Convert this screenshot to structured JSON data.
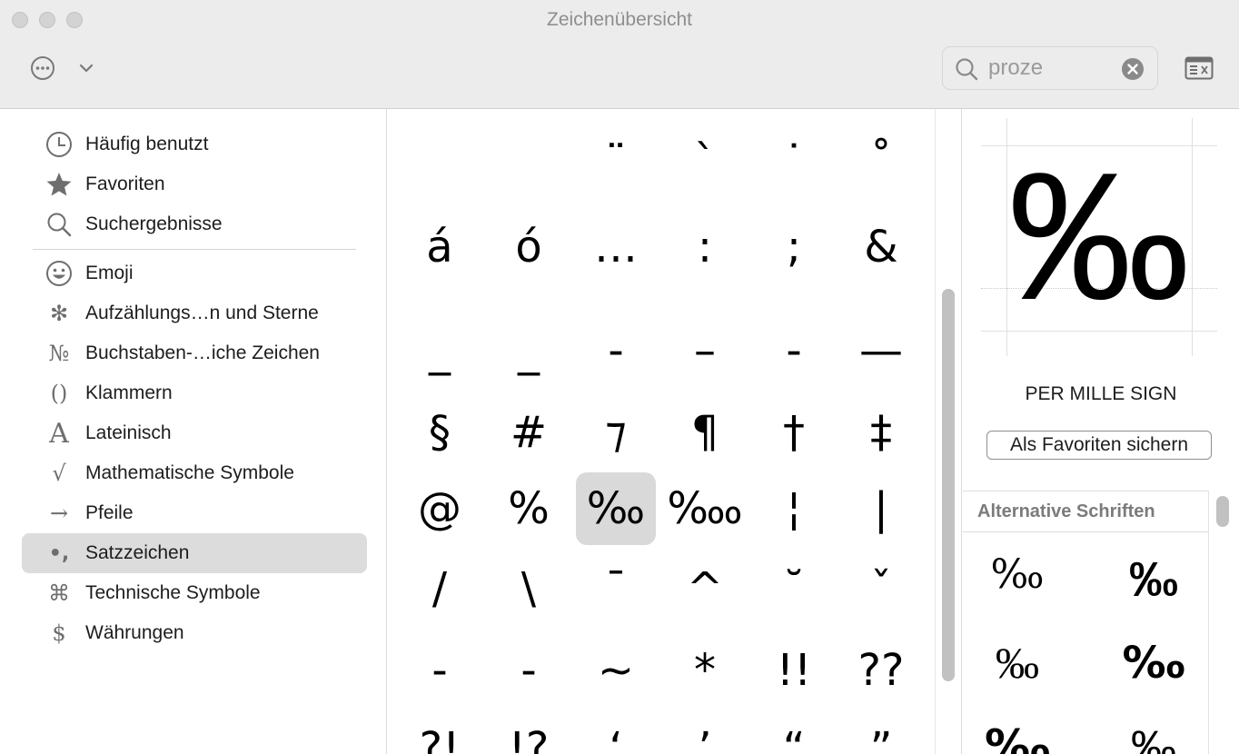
{
  "window": {
    "title": "Zeichenübersicht"
  },
  "toolbar": {
    "search_value": "proze",
    "icons": {
      "more": "ellipsis-circle-icon",
      "dropdown": "chevron-down-icon",
      "search": "magnifier-icon",
      "clear": "clear-x-icon",
      "keyboard_viewer": "keyboard-viewer-icon"
    }
  },
  "sidebar": {
    "items": [
      {
        "label": "Häufig benutzt",
        "icon": "clock-icon"
      },
      {
        "label": "Favoriten",
        "icon": "star-icon"
      },
      {
        "label": "Suchergebnisse",
        "icon": "magnifier-icon"
      },
      {
        "label": "Emoji",
        "icon": "smiley-icon",
        "glyph": "☺"
      },
      {
        "label": "Aufzählungs…n und Sterne",
        "icon": "asterisk-bullet-icon",
        "glyph": "✻"
      },
      {
        "label": "Buchstaben-…iche Zeichen",
        "icon": "numero-icon",
        "glyph": "№"
      },
      {
        "label": "Klammern",
        "icon": "parentheses-icon",
        "glyph": "()"
      },
      {
        "label": "Lateinisch",
        "icon": "latin-a-icon",
        "glyph": "A"
      },
      {
        "label": "Mathematische Symbole",
        "icon": "square-root-icon",
        "glyph": "√"
      },
      {
        "label": "Pfeile",
        "icon": "arrow-right-icon",
        "glyph": "→"
      },
      {
        "label": "Satzzeichen",
        "icon": "punctuation-icon",
        "glyph": "•,"
      },
      {
        "label": "Technische Symbole",
        "icon": "command-icon",
        "glyph": "⌘"
      },
      {
        "label": "Währungen",
        "icon": "dollar-icon",
        "glyph": "$"
      }
    ],
    "selected": "Satzzeichen"
  },
  "grid": {
    "rows": [
      [
        "",
        "",
        "¨",
        "`",
        "˙",
        "˚"
      ],
      [
        "á",
        "ó",
        "…",
        ":",
        ";",
        "&"
      ],
      [
        "_",
        "_",
        "‐",
        "–",
        "‑",
        "—"
      ],
      [
        "§",
        "#",
        "⁊",
        "¶",
        "†",
        "‡"
      ],
      [
        "@",
        "%",
        "‰",
        "‱",
        "¦",
        "|"
      ],
      [
        "/",
        "\\",
        "¯",
        "^",
        "˘",
        "ˇ"
      ],
      [
        "-",
        "-",
        "~",
        "*",
        "!!",
        "??"
      ],
      [
        "?!",
        "!?",
        "‘",
        "’",
        "“",
        "”"
      ]
    ],
    "selected": "‰"
  },
  "info": {
    "glyph": "‰",
    "name": "PER MILLE SIGN",
    "favorite_button": "Als Favoriten sichern",
    "alternatives_title": "Alternative Schriften",
    "alternatives": [
      "‰",
      "‰",
      "‰",
      "‰",
      "‰",
      "‰"
    ]
  }
}
